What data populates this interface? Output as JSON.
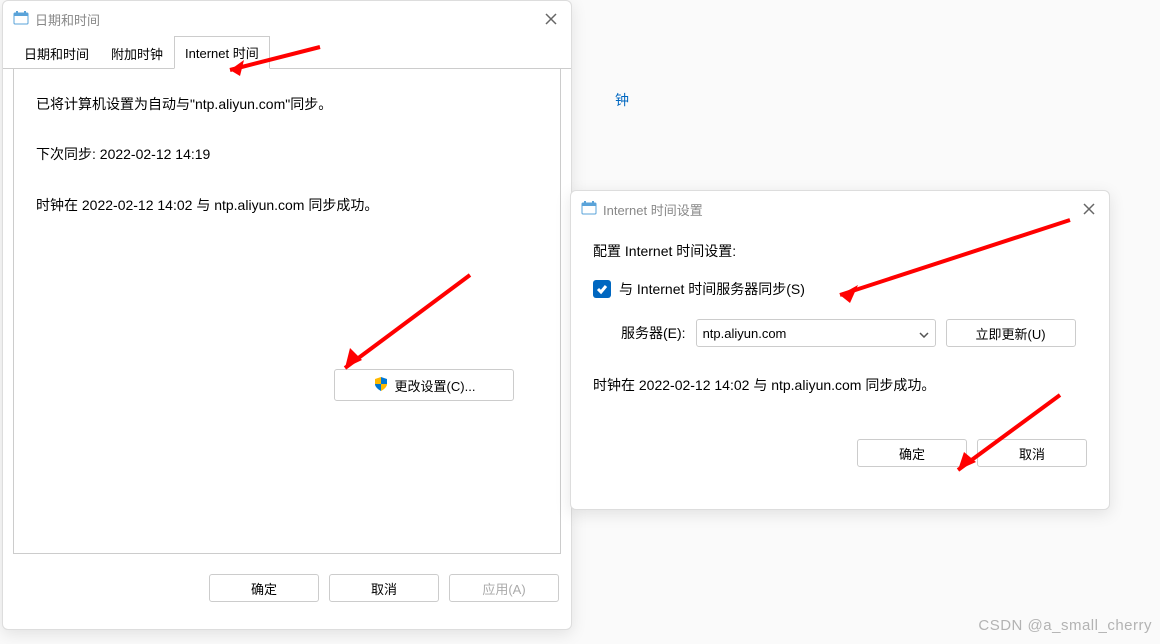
{
  "background": {
    "partial_link_text": "钟"
  },
  "dialog1": {
    "title": "日期和时间",
    "tabs": [
      {
        "label": "日期和时间"
      },
      {
        "label": "附加时钟"
      },
      {
        "label": "Internet 时间"
      }
    ],
    "sync_status": "已将计算机设置为自动与\"ntp.aliyun.com\"同步。",
    "next_sync": "下次同步: 2022-02-12 14:19",
    "last_sync": "时钟在 2022-02-12 14:02 与 ntp.aliyun.com 同步成功。",
    "change_settings": "更改设置(C)...",
    "buttons": {
      "ok": "确定",
      "cancel": "取消",
      "apply": "应用(A)"
    }
  },
  "dialog2": {
    "title": "Internet 时间设置",
    "config_label": "配置 Internet 时间设置:",
    "checkbox_label": "与 Internet 时间服务器同步(S)",
    "checkbox_checked": true,
    "server_label": "服务器(E):",
    "server_value": "ntp.aliyun.com",
    "update_now": "立即更新(U)",
    "last_sync": "时钟在 2022-02-12 14:02 与 ntp.aliyun.com 同步成功。",
    "buttons": {
      "ok": "确定",
      "cancel": "取消"
    }
  },
  "watermark": "CSDN @a_small_cherry"
}
